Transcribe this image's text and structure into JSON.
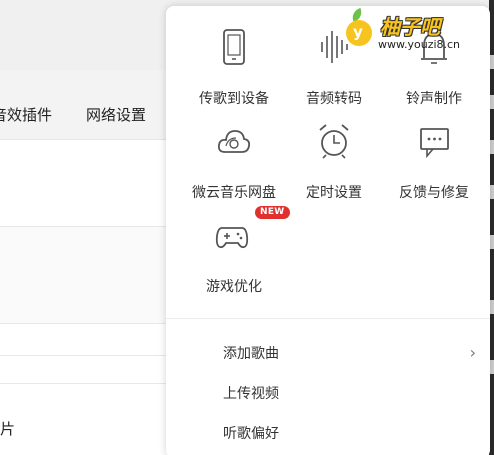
{
  "background_app": {
    "tabs": [
      "音效插件",
      "网络设置"
    ],
    "bottom_text": "片"
  },
  "menu": {
    "tools": [
      {
        "label": "传歌到设备",
        "icon": "phone-icon"
      },
      {
        "label": "音频转码",
        "icon": "audio-wave-icon"
      },
      {
        "label": "铃声制作",
        "icon": "bell-icon"
      },
      {
        "label": "微云音乐网盘",
        "icon": "cloud-icon"
      },
      {
        "label": "定时设置",
        "icon": "alarm-clock-icon"
      },
      {
        "label": "反馈与修复",
        "icon": "feedback-icon"
      },
      {
        "label": "游戏优化",
        "icon": "gamepad-icon",
        "badge": "NEW"
      }
    ],
    "items": [
      {
        "label": "添加歌曲",
        "chevron": "›"
      },
      {
        "label": "上传视频"
      },
      {
        "label": "听歌偏好"
      }
    ]
  },
  "watermark": {
    "logo_letter": "y",
    "brand": "柚子吧",
    "url": "www.youzi8.cn"
  },
  "colors": {
    "badge": "#e0312f",
    "logo_yellow": "#f7c31e"
  }
}
